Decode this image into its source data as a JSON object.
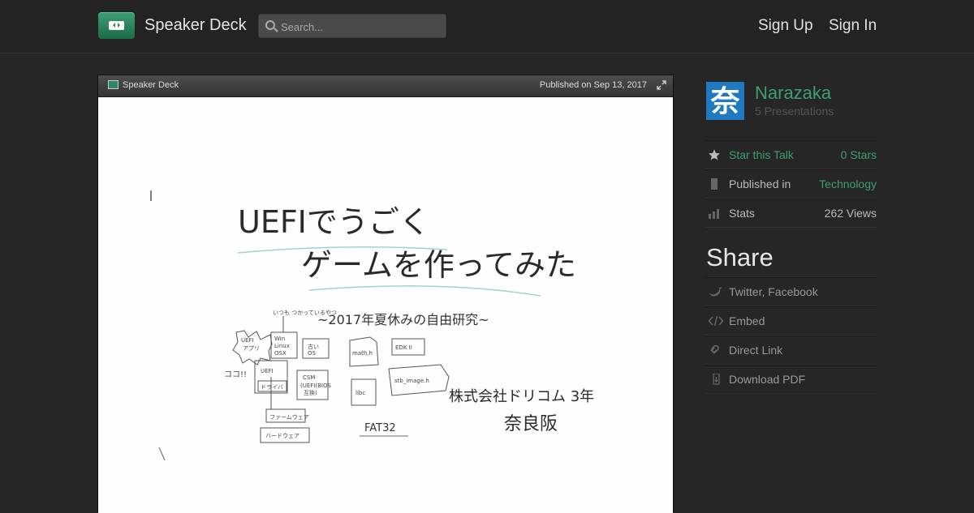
{
  "header": {
    "brand": "Speaker Deck",
    "search_placeholder": "Search...",
    "sign_up": "Sign Up",
    "sign_in": "Sign In"
  },
  "player": {
    "brand": "Speaker Deck",
    "published": "Published on Sep 13, 2017"
  },
  "slide": {
    "title_line1": "UEFIでうごく",
    "title_line2": "ゲームを作ってみた",
    "subtitle": "~2017年夏休みの自由研究~",
    "affiliation": "株式会社ドリコム 3年",
    "author": "奈良阪",
    "diagram": {
      "note": "いつも\nつかっているやつ",
      "here": "ココ!!",
      "boxes": [
        "UEFI\nアプリ",
        "Win\nLinux\nOSX",
        "古い\nOS",
        "UEFI",
        "ドライバ",
        "CSM\n(UEFI(BIOS\n互換)",
        "ファームウェア",
        "ハードウェア",
        "math.h",
        "EDK II",
        "libc",
        "stb_image.h",
        "FAT32"
      ]
    }
  },
  "sidebar": {
    "avatar_char": "奈",
    "author_name": "Narazaka",
    "author_sub": "5 Presentations",
    "stats": [
      {
        "icon": "star-icon",
        "label": "Star this Talk",
        "value": "0 Stars"
      },
      {
        "icon": "bookmark-icon",
        "label": "Published in",
        "value": "Technology"
      },
      {
        "icon": "bar-chart-icon",
        "label": "Stats",
        "value": "262 Views"
      }
    ],
    "share_title": "Share",
    "share": [
      {
        "icon": "bird-icon",
        "label": "Twitter, Facebook"
      },
      {
        "icon": "code-icon",
        "label": "Embed"
      },
      {
        "icon": "link-icon",
        "label": "Direct Link"
      },
      {
        "icon": "download-icon",
        "label": "Download PDF"
      }
    ]
  },
  "colors": {
    "accent": "#3d9e70",
    "background": "#262626",
    "avatar": "#1f7ac0"
  }
}
